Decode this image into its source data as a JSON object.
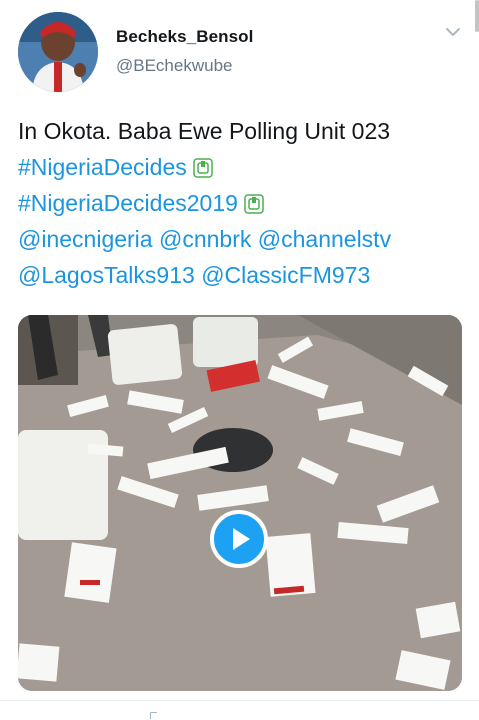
{
  "user": {
    "display_name": "Becheks_Bensol",
    "handle": "@BEchekwube"
  },
  "tweet": {
    "line1": "In Okota. Baba Ewe Polling Unit 023",
    "hashtag1": "#NigeriaDecides",
    "hashtag2": "#NigeriaDecides2019",
    "mention1": "@inecnigeria",
    "mention2": "@cnnbrk",
    "mention3": "@channelstv",
    "mention4": "@LagosTalks913",
    "mention5": "@ClassicFM973"
  },
  "icons": {
    "menu": "chevron-down-icon",
    "ballot_emoji": "ballot-box-emoji-icon",
    "play": "play-icon"
  },
  "colors": {
    "link": "#1b95e0",
    "play_button": "#1da1f2",
    "handle_gray": "#657786"
  }
}
